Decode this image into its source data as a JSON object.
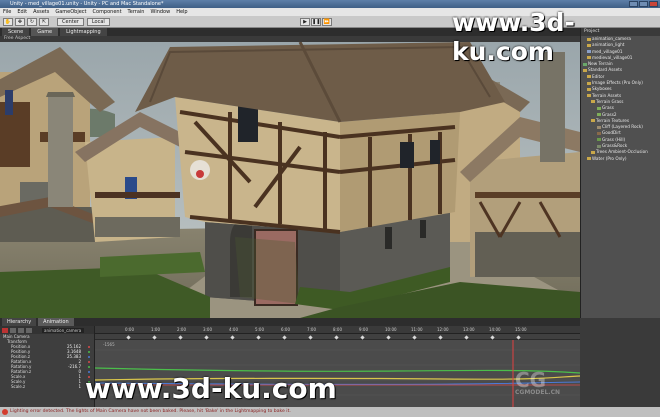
{
  "window": {
    "title": "Unity - med_village01.unity - Unity - PC and Mac Standalone*"
  },
  "menu": [
    "File",
    "Edit",
    "Assets",
    "GameObject",
    "Component",
    "Terrain",
    "Window",
    "Help"
  ],
  "toolbar": {
    "pivot_label": "Center",
    "space_label": "Local"
  },
  "scene_tabs": [
    {
      "label": "Scene",
      "active": false
    },
    {
      "label": "Game",
      "active": true
    },
    {
      "label": "Lightmapping",
      "active": false
    }
  ],
  "scene_aspect": "Free Aspect",
  "project": {
    "header": "Project",
    "items": [
      {
        "label": "animation_camera",
        "depth": 1,
        "icon": "folder-icon"
      },
      {
        "label": "animation_light",
        "depth": 1,
        "icon": "folder-icon"
      },
      {
        "label": "med_village01",
        "depth": 1,
        "icon": "scene-icon"
      },
      {
        "label": "medieval_village01",
        "depth": 1,
        "icon": "folder-icon"
      },
      {
        "label": "New Terrain",
        "depth": 0,
        "icon": "terrain-icon"
      },
      {
        "label": "Standard Assets",
        "depth": 0,
        "icon": "folder-icon"
      },
      {
        "label": "Editor",
        "depth": 1,
        "icon": "folder-icon"
      },
      {
        "label": "Image Effects (Pro Only)",
        "depth": 1,
        "icon": "folder-icon"
      },
      {
        "label": "Skyboxes",
        "depth": 1,
        "icon": "folder-icon"
      },
      {
        "label": "Terrain Assets",
        "depth": 1,
        "icon": "folder-icon"
      },
      {
        "label": "Terrain Grass",
        "depth": 2,
        "icon": "folder-icon"
      },
      {
        "label": "Grass",
        "depth": 3,
        "icon": "texture-icon"
      },
      {
        "label": "Grass2",
        "depth": 3,
        "icon": "texture-icon"
      },
      {
        "label": "Terrain Textures",
        "depth": 2,
        "icon": "folder-icon"
      },
      {
        "label": "Cliff (Layered Rock)",
        "depth": 3,
        "icon": "texture-icon"
      },
      {
        "label": "GoodDirt",
        "depth": 3,
        "icon": "texture-icon"
      },
      {
        "label": "Grass (Hill)",
        "depth": 3,
        "icon": "texture-icon"
      },
      {
        "label": "Grass&Rock",
        "depth": 3,
        "icon": "texture-icon"
      },
      {
        "label": "Trees Ambient-Occlusion",
        "depth": 2,
        "icon": "folder-icon"
      },
      {
        "label": "Water (Pro Only)",
        "depth": 1,
        "icon": "folder-icon"
      }
    ]
  },
  "anim_tabs": [
    {
      "label": "Hierarchy",
      "active": false
    },
    {
      "label": "Animation",
      "active": true
    }
  ],
  "animation": {
    "clip_name": "animation_camera",
    "properties": [
      {
        "label": "Main Camera",
        "value": "",
        "color": ""
      },
      {
        "label": "Transform",
        "value": "",
        "color": ""
      },
      {
        "label": "Position.x",
        "value": "25.162",
        "color": "#d94b4b"
      },
      {
        "label": "Position.y",
        "value": "3.1648",
        "color": "#4bbf4b"
      },
      {
        "label": "Position.z",
        "value": "25.383",
        "color": "#4b7bd9"
      },
      {
        "label": "Rotation.x",
        "value": "2",
        "color": "#d94b4b"
      },
      {
        "label": "Rotation.y",
        "value": "-216.7",
        "color": "#4bbf4b"
      },
      {
        "label": "Rotation.z",
        "value": "0",
        "color": "#4b7bd9"
      },
      {
        "label": "Scale.x",
        "value": "1",
        "color": "#d94b4b"
      },
      {
        "label": "Scale.y",
        "value": "1",
        "color": "#4bbf4b"
      },
      {
        "label": "Scale.z",
        "value": "1",
        "color": "#4b7bd9"
      }
    ],
    "ruler_ticks": [
      "0:00",
      "1:00",
      "2:00",
      "3:00",
      "4:00",
      "5:00",
      "6:00",
      "7:00",
      "8:00",
      "9:00",
      "10:00",
      "11:00",
      "12:00",
      "13:00",
      "14:00",
      "15:00"
    ],
    "graph_label": "-1565"
  },
  "status": {
    "message": "Lighting error detected. The lights of Main Camera have not been baked. Please, hit 'Bake' in the Lightmapping to bake it."
  },
  "watermarks": {
    "top": "www.3d-ku.com",
    "bottom": "www.3d-ku.com",
    "cg": "CG",
    "cg_sub": "CGMODEL.CN"
  },
  "colors": {
    "accent": "#3f5f86",
    "error": "#d43c2e",
    "playhead": "#e04040"
  }
}
